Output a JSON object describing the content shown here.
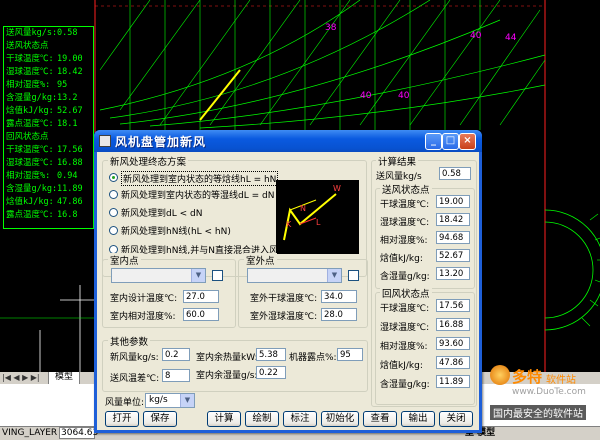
{
  "cad": {
    "left_panel": [
      {
        "label": "送风量kg/s:",
        "value": "0.58"
      },
      {
        "label": "送风状态点",
        "value": ""
      },
      {
        "label": "干球温度℃:",
        "value": "19.00"
      },
      {
        "label": "湿球温度℃:",
        "value": "18.42"
      },
      {
        "label": "相对湿度%:",
        "value": "95"
      },
      {
        "label": "含湿量g/kg:",
        "value": "13.2"
      },
      {
        "label": "焓值kJ/kg:",
        "value": "52.67"
      },
      {
        "label": "露点温度℃:",
        "value": "18.1"
      },
      {
        "label": "回风状态点",
        "value": ""
      },
      {
        "label": "干球温度℃:",
        "value": "17.56"
      },
      {
        "label": "湿球温度℃:",
        "value": "16.88"
      },
      {
        "label": "相对湿度%:",
        "value": "0.94"
      },
      {
        "label": "含湿量g/kg:",
        "value": "11.89"
      },
      {
        "label": "焓值kJ/kg:",
        "value": "47.86"
      },
      {
        "label": "露点温度℃:",
        "value": "16.8"
      }
    ],
    "layout_tab": "模型",
    "status_layer": "VING_LAYER",
    "status_coord": "3064.63",
    "status_right": "型 模型",
    "watermark": {
      "brand": "多特",
      "suffix": "软件站",
      "url": "www.DuoTe.com",
      "slogan": "国内最安全的软件站"
    }
  },
  "dialog": {
    "title": "风机盘管加新风",
    "scheme_group": "新风处理终态方案",
    "options": [
      "新风处理到室内状态的等焓线hL = hN",
      "新风处理到室内状态的等湿线dL = dN",
      "新风处理到dL < dN",
      "新风处理到hN线(hL < hN)",
      "新风处理到hN线,并与N直接混合进入风盘"
    ],
    "selected_option": 0,
    "preview_labels": [
      "W",
      "N",
      "L",
      "K"
    ],
    "indoor": {
      "group": "室内点",
      "temp_label": "室内设计温度℃:",
      "temp_value": "27.0",
      "rh_label": "室内相对湿度%:",
      "rh_value": "60.0"
    },
    "outdoor": {
      "group": "室外点",
      "dry_label": "室外干球温度℃:",
      "dry_value": "34.0",
      "wet_label": "室外湿球温度℃:",
      "wet_value": "28.0"
    },
    "other": {
      "group": "其他参数",
      "fresh_label": "新风量kg/s:",
      "fresh_value": "0.2",
      "heat_label": "室内余热量kW:",
      "heat_value": "5.38",
      "dew_label": "机器露点%:",
      "dew_value": "95",
      "supply_diff_label": "送风温差℃:",
      "supply_diff_value": "8",
      "moist_label": "室内余湿量g/s:",
      "moist_value": "0.22"
    },
    "unit_label": "风量单位:",
    "unit_value": "kg/s",
    "buttons": [
      "打开",
      "保存",
      "计算",
      "绘制",
      "标注",
      "初始化",
      "查看",
      "输出",
      "关闭"
    ],
    "results": {
      "group": "计算结果",
      "supply_label": "送风量kg/s",
      "supply_value": "0.58",
      "supply_state": {
        "group": "送风状态点",
        "rows": [
          {
            "label": "干球温度℃:",
            "value": "19.00"
          },
          {
            "label": "湿球温度℃:",
            "value": "18.42"
          },
          {
            "label": "相对湿度%:",
            "value": "94.68"
          },
          {
            "label": "焓值kJ/kg:",
            "value": "52.67"
          },
          {
            "label": "含湿量g/kg:",
            "value": "13.20"
          }
        ]
      },
      "return_state": {
        "group": "回风状态点",
        "rows": [
          {
            "label": "干球温度℃:",
            "value": "17.56"
          },
          {
            "label": "湿球温度℃:",
            "value": "16.88"
          },
          {
            "label": "相对湿度%:",
            "value": "93.60"
          },
          {
            "label": "焓值kJ/kg:",
            "value": "47.86"
          },
          {
            "label": "含湿量g/kg:",
            "value": "11.89"
          }
        ]
      }
    }
  }
}
